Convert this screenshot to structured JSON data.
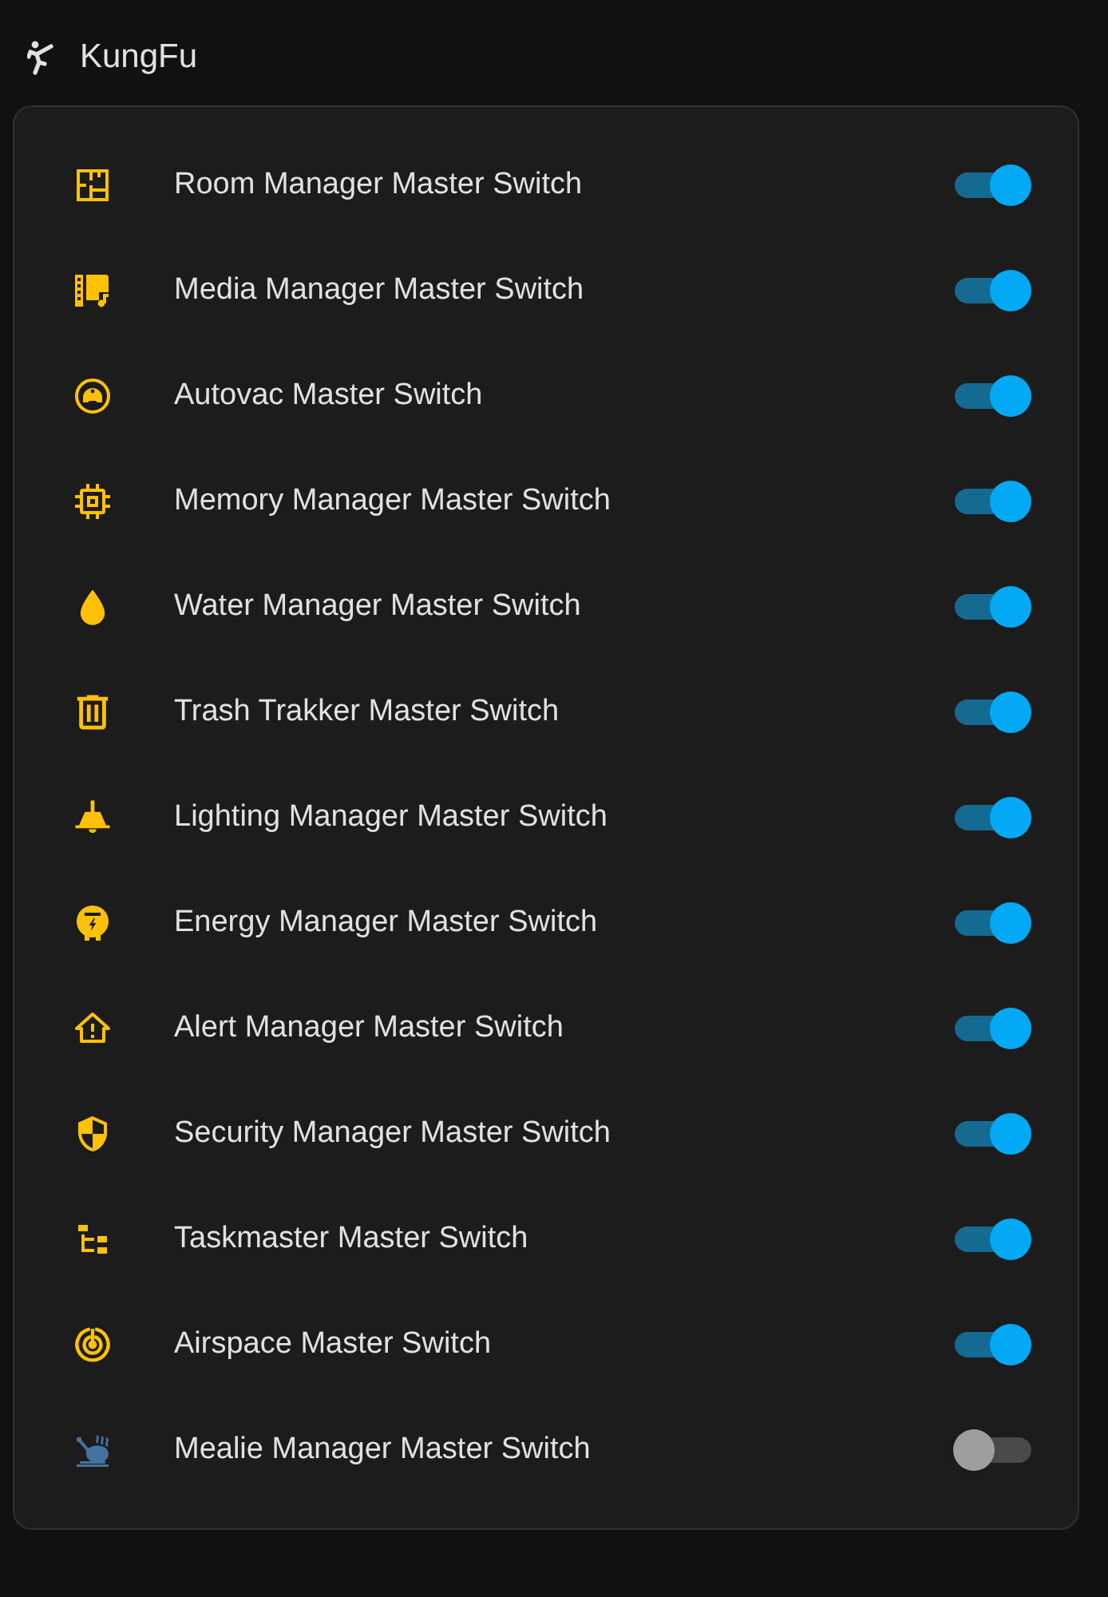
{
  "header": {
    "title": "KungFu"
  },
  "rows": [
    {
      "kind": "floor-plan",
      "label": "Room Manager Master Switch",
      "on": true
    },
    {
      "kind": "media",
      "label": "Media Manager Master Switch",
      "on": true
    },
    {
      "kind": "robot-vacuum",
      "label": "Autovac Master Switch",
      "on": true
    },
    {
      "kind": "chip",
      "label": "Memory Manager Master Switch",
      "on": true
    },
    {
      "kind": "water",
      "label": "Water Manager Master Switch",
      "on": true
    },
    {
      "kind": "trash",
      "label": "Trash Trakker Master Switch",
      "on": true
    },
    {
      "kind": "ceiling-light",
      "label": "Lighting Manager Master Switch",
      "on": true
    },
    {
      "kind": "meter",
      "label": "Energy Manager Master Switch",
      "on": true
    },
    {
      "kind": "home-alert",
      "label": "Alert Manager Master Switch",
      "on": true
    },
    {
      "kind": "shield",
      "label": "Security Manager Master Switch",
      "on": true
    },
    {
      "kind": "tree",
      "label": "Taskmaster Master Switch",
      "on": true
    },
    {
      "kind": "radar",
      "label": "Airspace Master Switch",
      "on": true
    },
    {
      "kind": "turkey",
      "label": "Mealie Manager Master Switch",
      "on": false
    }
  ]
}
